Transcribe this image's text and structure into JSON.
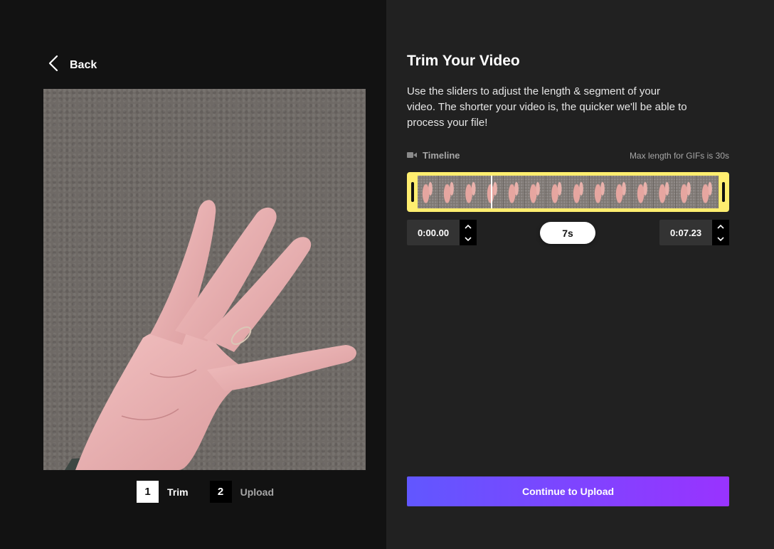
{
  "nav": {
    "back_label": "Back"
  },
  "steps": [
    {
      "number": "1",
      "label": "Trim",
      "active": true
    },
    {
      "number": "2",
      "label": "Upload",
      "active": false
    }
  ],
  "trim": {
    "title": "Trim Your Video",
    "description": "Use the sliders to adjust the length & segment of your video. The shorter your video is, the quicker we'll be able to process your file!",
    "timeline_label": "Timeline",
    "max_length_note": "Max length for GIFs is 30s",
    "start_time": "0:00.00",
    "end_time": "0:07.23",
    "duration": "7s"
  },
  "actions": {
    "continue_label": "Continue to Upload"
  },
  "icons": {
    "back": "chevron-left-icon",
    "timeline": "video-camera-icon",
    "increment": "chevron-up-icon",
    "decrement": "chevron-down-icon"
  },
  "colors": {
    "left_bg": "#121212",
    "right_bg": "#212121",
    "timeline_border": "#ffee6f",
    "button_gradient_start": "#6157ff",
    "button_gradient_end": "#9933ff"
  }
}
